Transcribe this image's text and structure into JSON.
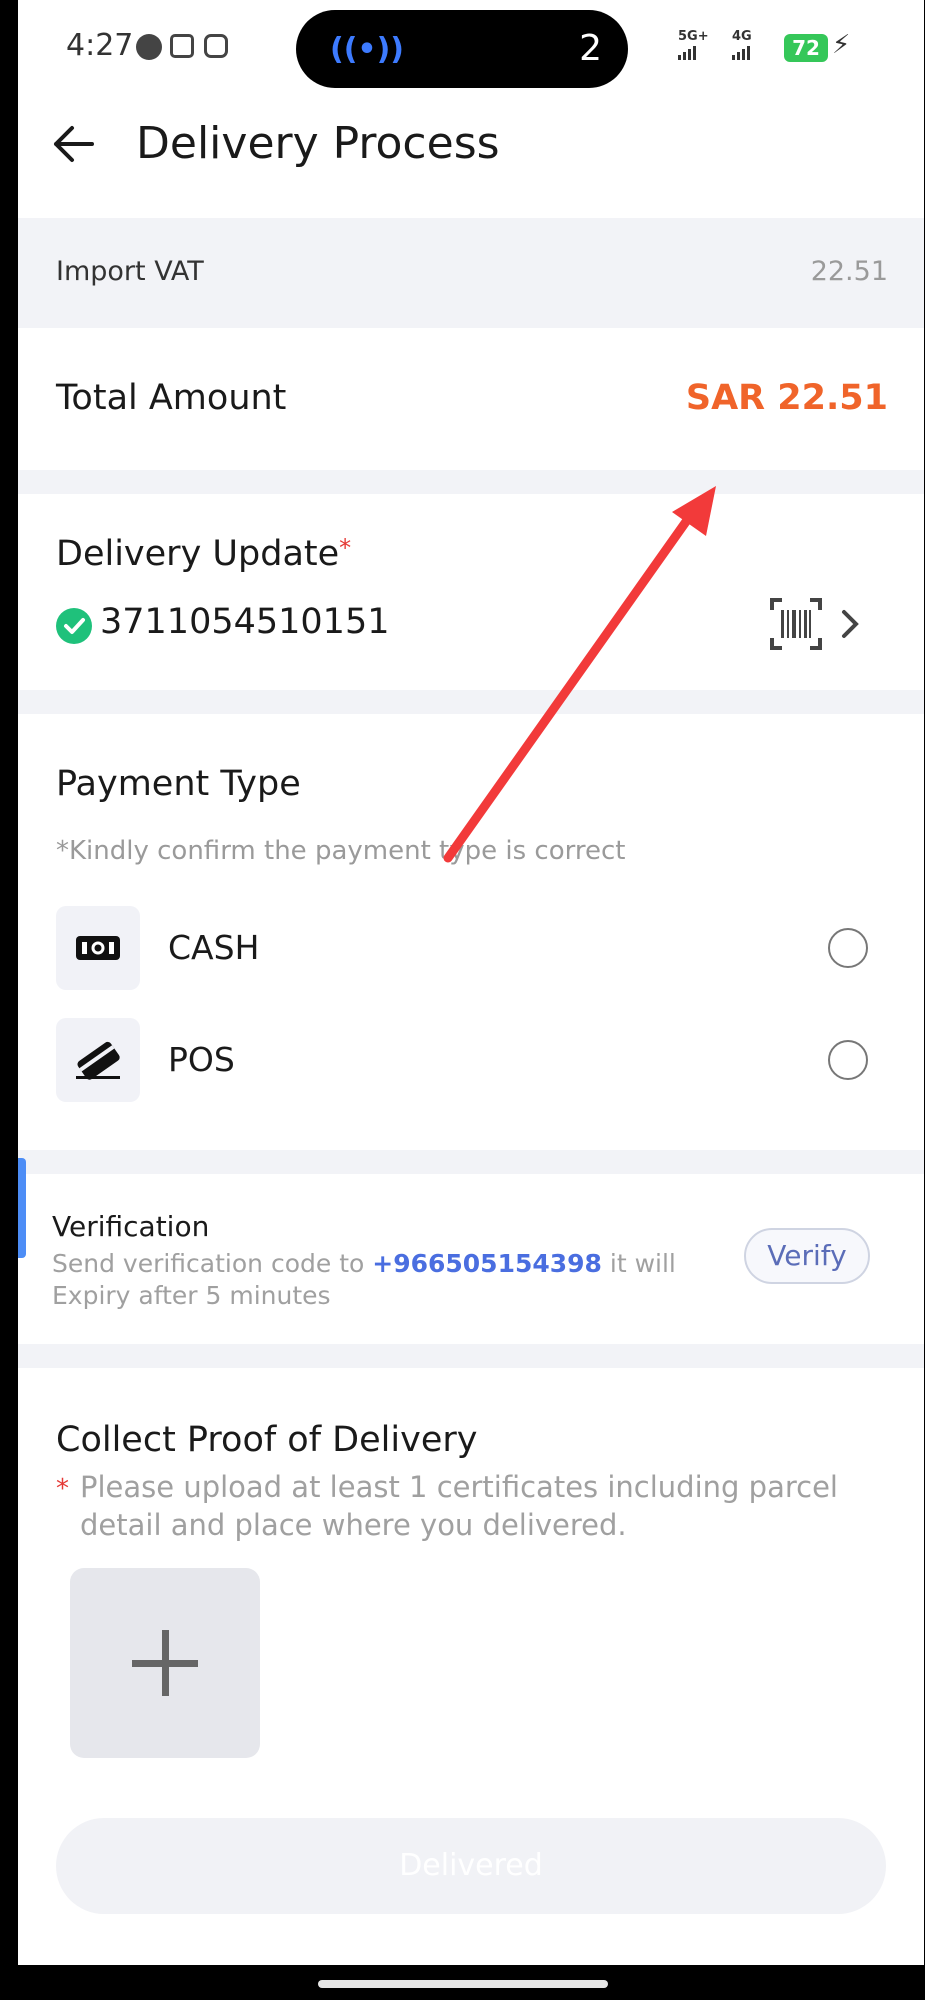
{
  "status_bar": {
    "time": "4:27",
    "island_count": "2",
    "net1": "5G+",
    "net2": "4G",
    "battery": "72"
  },
  "header": {
    "title": "Delivery Process"
  },
  "fees": {
    "import_vat_label": "Import VAT",
    "import_vat_value": "22.51",
    "total_label": "Total Amount",
    "total_value": "SAR 22.51"
  },
  "delivery_update": {
    "label": "Delivery Update",
    "required_mark": "*",
    "tracking_number": "3711054510151"
  },
  "payment": {
    "label": "Payment Type",
    "note": "*Kindly confirm the payment type is correct",
    "options": [
      {
        "label": "CASH",
        "icon": "cash-icon"
      },
      {
        "label": "POS",
        "icon": "card-icon"
      }
    ]
  },
  "verification": {
    "label": "Verification",
    "text_before": "Send verification code to ",
    "phone": "+966505154398",
    "text_after": " it will Expiry after 5 minutes",
    "verify_button": "Verify"
  },
  "proof": {
    "label": "Collect Proof of Delivery",
    "star": "*",
    "note": "Please upload at least 1 certificates including parcel detail and place where you delivered."
  },
  "footer": {
    "delivered_button": "Delivered"
  },
  "colors": {
    "accent_orange": "#f0642a",
    "success_green": "#1fc17b",
    "link_blue": "#4a6ee0",
    "annotation_red": "#f23a3a"
  }
}
